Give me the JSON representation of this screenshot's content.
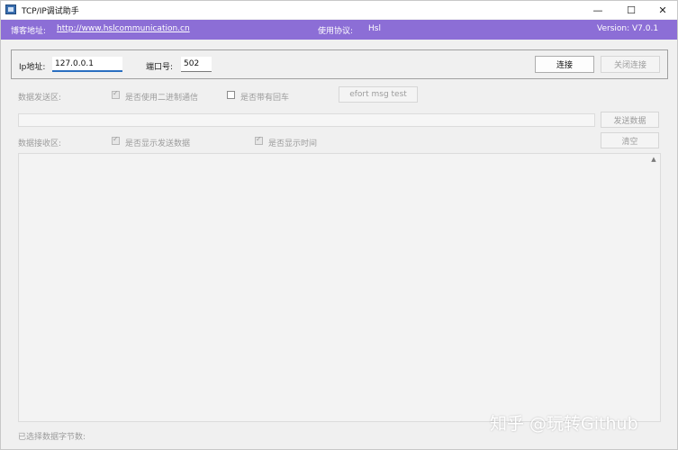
{
  "window": {
    "title": "TCP/IP调试助手",
    "controls": {
      "minimize": "—",
      "maximize": "☐",
      "close": "✕"
    }
  },
  "infobar": {
    "blog_label": "博客地址:",
    "blog_link": "http://www.hslcommunication.cn",
    "protocol_label": "使用协议:",
    "protocol_value": "Hsl",
    "version": "Version: V7.0.1",
    "background_color": "#8c6ed6"
  },
  "connection": {
    "ip_label": "Ip地址:",
    "ip_value": "127.0.0.1",
    "port_label": "端口号:",
    "port_value": "502",
    "connect_label": "连接",
    "disconnect_label": "关闭连接"
  },
  "send": {
    "area_label": "数据发送区:",
    "binary_label": "是否使用二进制通信",
    "binary_checked": true,
    "cr_label": "是否带有回车",
    "cr_checked": false,
    "test_button": "efort msg test",
    "send_button": "发送数据",
    "input_value": ""
  },
  "receive": {
    "area_label": "数据接收区:",
    "show_send_label": "是否显示发送数据",
    "show_send_checked": true,
    "show_time_label": "是否显示时间",
    "show_time_checked": true,
    "clear_button": "清空"
  },
  "status": {
    "bytes_label": "已选择数据字节数:"
  },
  "watermark": "知乎 @玩转Github"
}
